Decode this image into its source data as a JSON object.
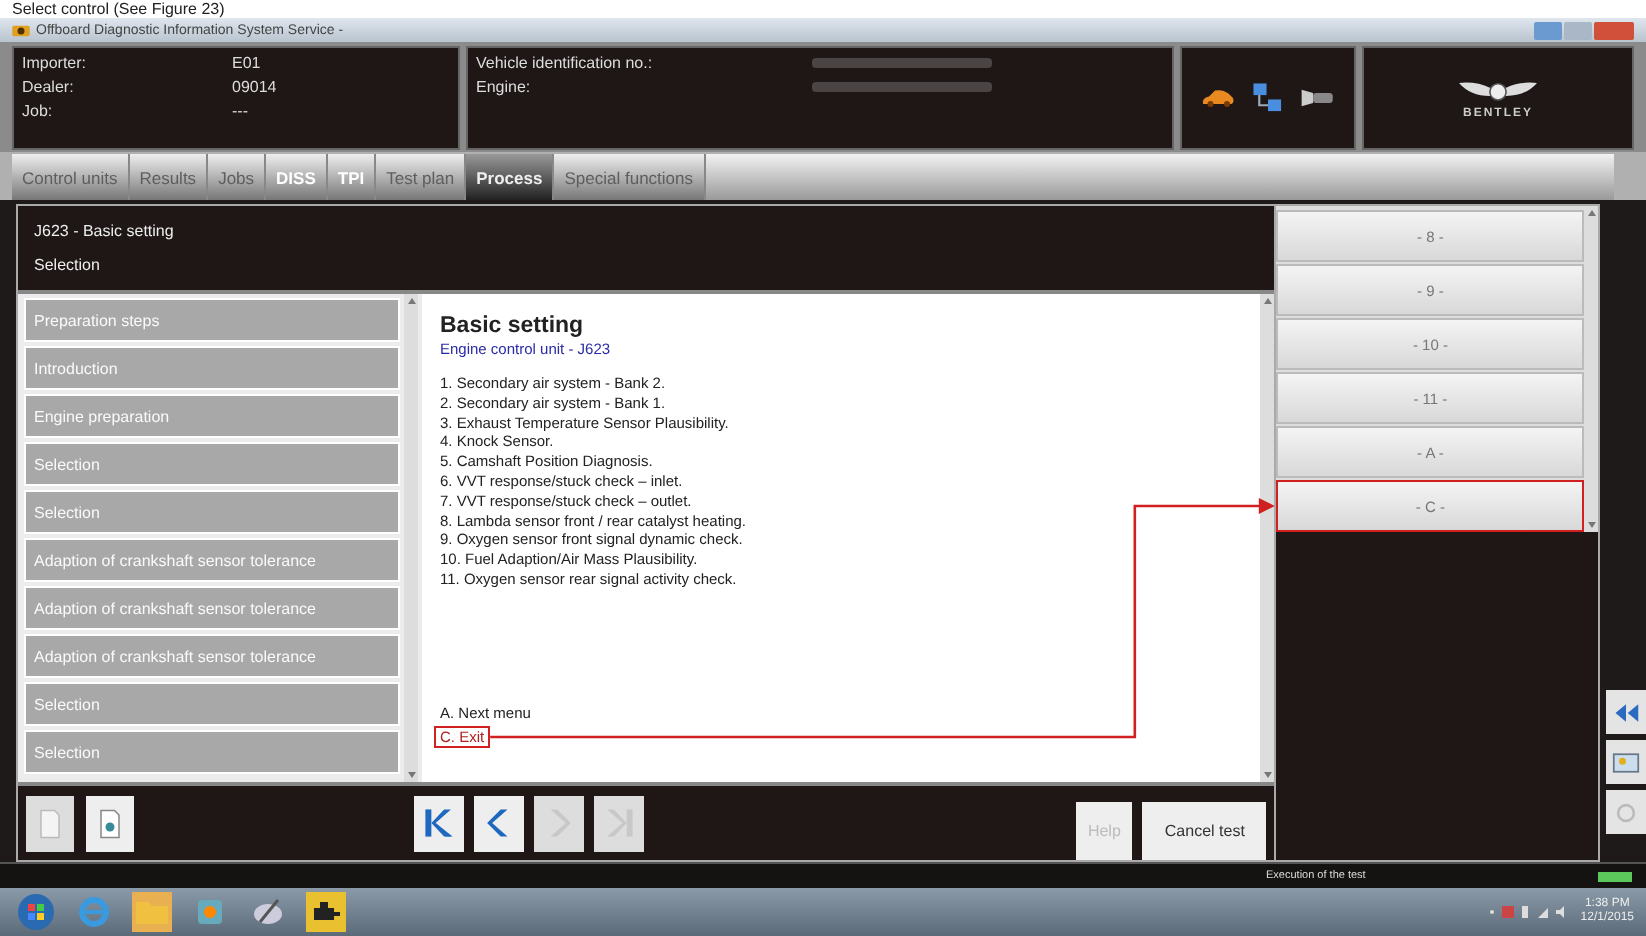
{
  "caption": "Select control (See Figure 23)",
  "window": {
    "title": "Offboard Diagnostic Information System Service -"
  },
  "header": {
    "info": [
      {
        "label": "Importer:",
        "value": "E01"
      },
      {
        "label": "Dealer:",
        "value": "09014"
      },
      {
        "label": "Job:",
        "value": "---"
      }
    ],
    "vehicle": [
      {
        "label": "Vehicle identification no.:"
      },
      {
        "label": "Engine:"
      }
    ],
    "brand": "BENTLEY"
  },
  "tabs": [
    {
      "label": "Control units",
      "selected": false,
      "disabled": true
    },
    {
      "label": "Results",
      "selected": false,
      "disabled": true
    },
    {
      "label": "Jobs",
      "selected": false,
      "disabled": true
    },
    {
      "label": "DISS",
      "selected": false,
      "disabled": false
    },
    {
      "label": "TPI",
      "selected": false,
      "disabled": false
    },
    {
      "label": "Test plan",
      "selected": false,
      "disabled": true
    },
    {
      "label": "Process",
      "selected": true,
      "disabled": false
    },
    {
      "label": "Special functions",
      "selected": false,
      "disabled": true
    }
  ],
  "process": {
    "title": "J623 - Basic setting",
    "subtitle": "Selection"
  },
  "steps": [
    {
      "label": "Preparation steps",
      "disabled": true
    },
    {
      "label": "Introduction",
      "disabled": true
    },
    {
      "label": "Engine preparation",
      "disabled": true
    },
    {
      "label": "Selection",
      "disabled": true
    },
    {
      "label": "Selection",
      "disabled": true
    },
    {
      "label": "Adaption of crankshaft sensor tolerance",
      "disabled": true
    },
    {
      "label": "Adaption of crankshaft sensor tolerance",
      "disabled": true
    },
    {
      "label": "Adaption of crankshaft sensor tolerance",
      "disabled": true
    },
    {
      "label": "Selection",
      "disabled": true
    },
    {
      "label": "Selection",
      "disabled": true
    }
  ],
  "content": {
    "heading": "Basic setting",
    "subheading": "Engine control unit - J623",
    "items": [
      "1. Secondary air system - Bank 2.",
      "2. Secondary air system - Bank 1.",
      "3. Exhaust Temperature Sensor Plausibility.",
      "4. Knock Sensor.",
      "5. Camshaft Position Diagnosis.",
      "6. VVT response/stuck check – inlet.",
      "7. VVT response/stuck check – outlet.",
      "8. Lambda sensor front / rear catalyst heating.",
      "9. Oxygen sensor front signal dynamic check.",
      "10. Fuel Adaption/Air Mass Plausibility.",
      "11. Oxygen sensor rear signal activity check."
    ],
    "options": [
      {
        "text": "A. Next menu",
        "highlighted": false
      },
      {
        "text": "C. Exit",
        "highlighted": true
      }
    ]
  },
  "nav_buttons": [
    {
      "kind": "first",
      "disabled": false
    },
    {
      "kind": "prev",
      "disabled": false
    },
    {
      "kind": "next",
      "disabled": true
    },
    {
      "kind": "last",
      "disabled": true
    }
  ],
  "actions": [
    {
      "label": "Help",
      "disabled": true
    },
    {
      "label": "Cancel test",
      "disabled": false
    }
  ],
  "choices": [
    {
      "label": "- 8 -",
      "highlighted": false
    },
    {
      "label": "- 9 -",
      "highlighted": false
    },
    {
      "label": "- 10 -",
      "highlighted": false
    },
    {
      "label": "- 11 -",
      "highlighted": false
    },
    {
      "label": "- A -",
      "highlighted": false
    },
    {
      "label": "- C -",
      "highlighted": true
    }
  ],
  "status_bar": {
    "text": "Execution of the test"
  },
  "taskbar": {
    "time": "1:38 PM",
    "date": "12/1/2015"
  }
}
